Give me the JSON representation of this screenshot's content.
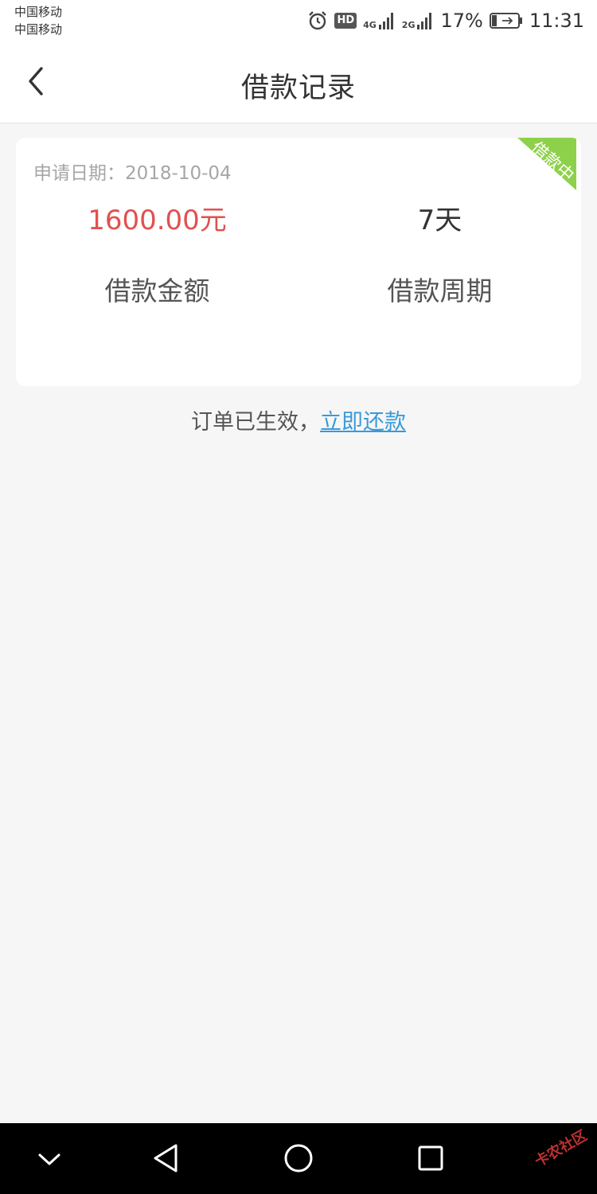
{
  "status_bar": {
    "carrier1": "中国移动",
    "carrier2": "中国移动",
    "hd": "HD",
    "net1": "4G",
    "net2": "2G",
    "battery_percent": "17%",
    "time": "11:31"
  },
  "header": {
    "title": "借款记录",
    "back_icon": "chevron-left-icon"
  },
  "loan_card": {
    "apply_date_label": "申请日期：",
    "apply_date": "2018-10-04",
    "status_badge": "借款中",
    "status_color": "#8dd14a",
    "amount": "1600.00元",
    "amount_color": "#e0514e",
    "amount_label": "借款金额",
    "period": "7天",
    "period_label": "借款周期"
  },
  "notice": {
    "text": "订单已生效，",
    "link": "立即还款",
    "link_color": "#3a9ad9"
  },
  "nav_bar": {
    "items": [
      "chevron-down-icon",
      "back-triangle-icon",
      "home-circle-icon",
      "recents-square-icon"
    ],
    "watermark": "卡农社区"
  }
}
